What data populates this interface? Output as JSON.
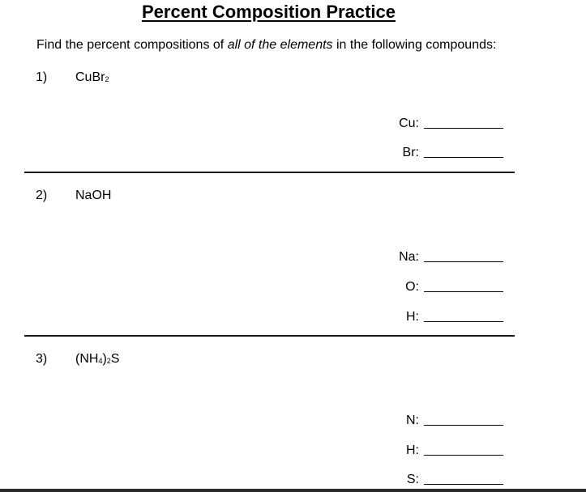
{
  "title": "Percent Composition Practice",
  "instructions": {
    "before": "Find the percent compositions of ",
    "emphasis": "all of the elements",
    "after": " in the following compounds:"
  },
  "problems": [
    {
      "number": "1)",
      "formula_parts": [
        {
          "text": "CuBr",
          "sub": "2"
        }
      ],
      "formula_tail": "",
      "elements": [
        {
          "label": "Cu:",
          "answer": ""
        },
        {
          "label": "Br:",
          "answer": ""
        }
      ]
    },
    {
      "number": "2)",
      "formula_parts": [
        {
          "text": "NaOH",
          "sub": ""
        }
      ],
      "formula_tail": "",
      "elements": [
        {
          "label": "Na:",
          "answer": ""
        },
        {
          "label": "O:",
          "answer": ""
        },
        {
          "label": "H:",
          "answer": ""
        }
      ]
    },
    {
      "number": "3)",
      "formula_parts": [
        {
          "text": "(NH",
          "sub": "4"
        },
        {
          "text": ")",
          "sub": "2"
        }
      ],
      "formula_tail": "S",
      "elements": [
        {
          "label": "N:",
          "answer": ""
        },
        {
          "label": "H:",
          "answer": ""
        },
        {
          "label": "S:",
          "answer": ""
        }
      ]
    }
  ]
}
